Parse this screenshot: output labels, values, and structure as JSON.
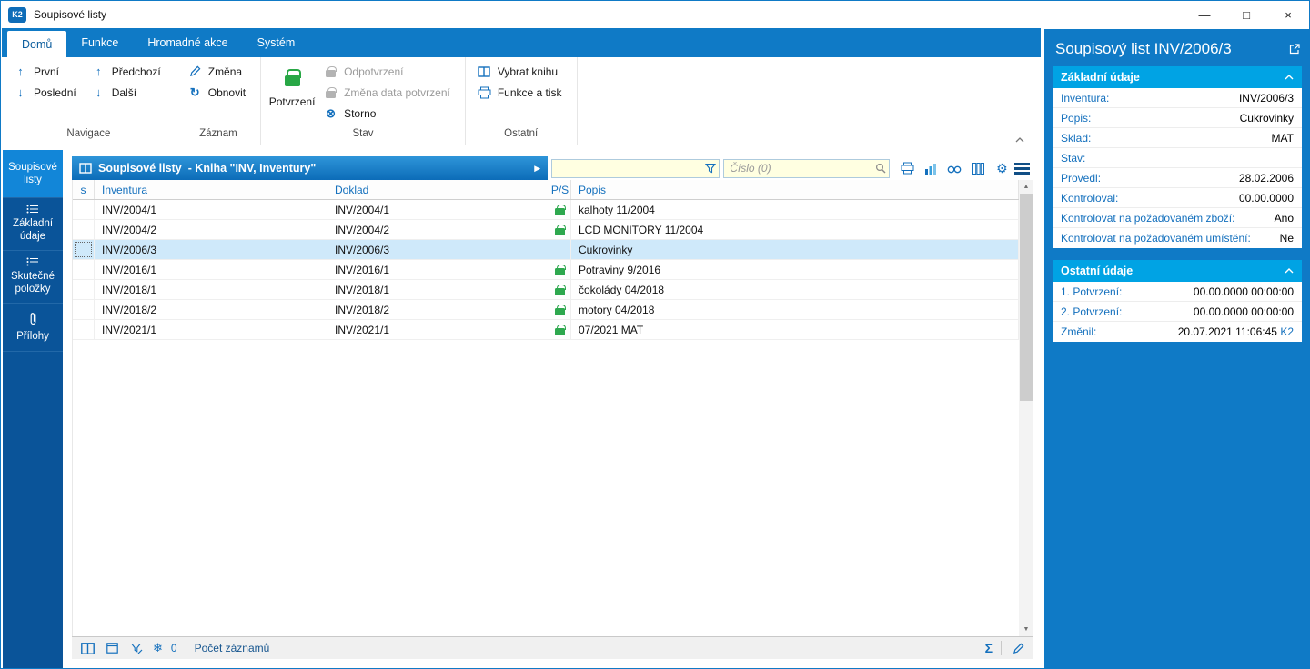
{
  "window": {
    "title": "Soupisové listy",
    "app_badge": "K2",
    "controls": {
      "minimize": "—",
      "maximize": "□",
      "close": "×"
    }
  },
  "ribbon": {
    "tabs": [
      {
        "label": "Domů",
        "active": true
      },
      {
        "label": "Funkce",
        "active": false
      },
      {
        "label": "Hromadné akce",
        "active": false
      },
      {
        "label": "Systém",
        "active": false
      }
    ],
    "navigace": {
      "label": "Navigace",
      "first": "První",
      "last": "Poslední",
      "prev": "Předchozí",
      "next": "Další"
    },
    "zaznam": {
      "label": "Záznam",
      "change": "Změna",
      "refresh": "Obnovit"
    },
    "stav": {
      "label": "Stav",
      "confirm": "Potvrzení",
      "unconfirm": "Odpotvrzení",
      "change_confirm_date": "Změna data potvrzení",
      "storno": "Storno"
    },
    "ostatni": {
      "label": "Ostatní",
      "select_book": "Vybrat knihu",
      "functions_print": "Funkce a tisk"
    }
  },
  "sidebar": {
    "items": [
      {
        "label": "Soupisové listy",
        "active": true
      },
      {
        "label": "Základní údaje",
        "active": false
      },
      {
        "label": "Skutečné položky",
        "active": false
      },
      {
        "label": "Přílohy",
        "active": false
      }
    ]
  },
  "table": {
    "title_bold": "Soupisové listy",
    "title_rest": " - Kniha \"INV, Inventury\"",
    "search_placeholder": "Číslo (0)",
    "columns": {
      "s": "s",
      "inventura": "Inventura",
      "doklad": "Doklad",
      "ps": "P/S",
      "popis": "Popis"
    },
    "rows": [
      {
        "inventura": "INV/2004/1",
        "doklad": "INV/2004/1",
        "locked": true,
        "popis": "kalhoty 11/2004",
        "selected": false
      },
      {
        "inventura": "INV/2004/2",
        "doklad": "INV/2004/2",
        "locked": true,
        "popis": "LCD MONITORY 11/2004",
        "selected": false
      },
      {
        "inventura": "INV/2006/3",
        "doklad": "INV/2006/3",
        "locked": false,
        "popis": "Cukrovinky",
        "selected": true
      },
      {
        "inventura": "INV/2016/1",
        "doklad": "INV/2016/1",
        "locked": true,
        "popis": "Potraviny 9/2016",
        "selected": false
      },
      {
        "inventura": "INV/2018/1",
        "doklad": "INV/2018/1",
        "locked": true,
        "popis": "čokolády 04/2018",
        "selected": false
      },
      {
        "inventura": "INV/2018/2",
        "doklad": "INV/2018/2",
        "locked": true,
        "popis": "motory 04/2018",
        "selected": false
      },
      {
        "inventura": "INV/2021/1",
        "doklad": "INV/2021/1",
        "locked": true,
        "popis": "07/2021 MAT",
        "selected": false
      }
    ],
    "status": {
      "count": "0",
      "records_label": "Počet záznamů"
    }
  },
  "detail": {
    "title": "Soupisový list INV/2006/3",
    "zakladni": {
      "title": "Základní údaje",
      "rows": [
        {
          "label": "Inventura:",
          "value": "INV/2006/3"
        },
        {
          "label": "Popis:",
          "value": "Cukrovinky"
        },
        {
          "label": "Sklad:",
          "value": "MAT"
        },
        {
          "label": "Stav:",
          "value": ""
        },
        {
          "label": "Provedl:",
          "value": "28.02.2006"
        },
        {
          "label": "Kontroloval:",
          "value": "00.00.0000"
        },
        {
          "label": "Kontrolovat na požadovaném zboží:",
          "value": "Ano"
        },
        {
          "label": "Kontrolovat na požadovaném umístění:",
          "value": "Ne"
        }
      ]
    },
    "ostatni": {
      "title": "Ostatní údaje",
      "rows": [
        {
          "label": "1. Potvrzení:",
          "value": "00.00.0000 00:00:00"
        },
        {
          "label": "2. Potvrzení:",
          "value": "00.00.0000 00:00:00"
        },
        {
          "label": "Změnil:",
          "value": "20.07.2021 11:06:45",
          "suffix": "K2"
        }
      ]
    }
  },
  "icons": {
    "up": "↑",
    "down": "↓",
    "refresh": "↻",
    "storno": "⊗",
    "gear": "⚙",
    "snowflake": "❄",
    "sigma": "Σ",
    "arrow_play": "▶",
    "scroll_up": "▲",
    "scroll_down": "▼"
  },
  "colors": {
    "accent_blue": "#0f7ac6",
    "card_header_blue": "#00a3e4",
    "lock_green": "#2fa94f",
    "input_yellow": "#ffffe1",
    "selected_row": "#cfe9fa",
    "sidebar_blue": "#0a5499"
  }
}
